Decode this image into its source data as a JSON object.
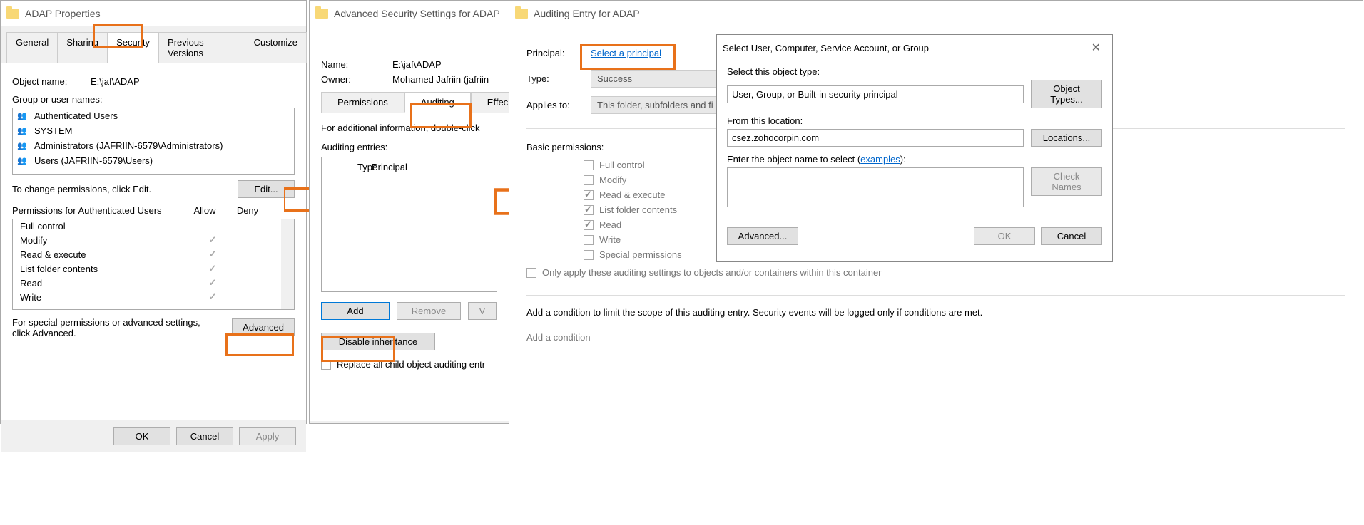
{
  "properties": {
    "title": "ADAP Properties",
    "tabs": {
      "general": "General",
      "sharing": "Sharing",
      "security": "Security",
      "previous": "Previous Versions",
      "customize": "Customize"
    },
    "object_name_label": "Object name:",
    "object_name": "E:\\jaf\\ADAP",
    "group_label": "Group or user names:",
    "groups": [
      "Authenticated Users",
      "SYSTEM",
      "Administrators (JAFRIIN-6579\\Administrators)",
      "Users (JAFRIIN-6579\\Users)"
    ],
    "change_text": "To change permissions, click Edit.",
    "edit_btn": "Edit...",
    "perm_header": "Permissions for Authenticated Users",
    "allow": "Allow",
    "deny": "Deny",
    "perms": [
      {
        "name": "Full control",
        "allow": false
      },
      {
        "name": "Modify",
        "allow": true
      },
      {
        "name": "Read & execute",
        "allow": true
      },
      {
        "name": "List folder contents",
        "allow": true
      },
      {
        "name": "Read",
        "allow": true
      },
      {
        "name": "Write",
        "allow": true
      }
    ],
    "special_text": "For special permissions or advanced settings, click Advanced.",
    "advanced_btn": "Advanced",
    "ok": "OK",
    "cancel": "Cancel",
    "apply": "Apply"
  },
  "advanced": {
    "title": "Advanced Security Settings for ADAP",
    "name_label": "Name:",
    "name": "E:\\jaf\\ADAP",
    "owner_label": "Owner:",
    "owner": "Mohamed Jafriin (jafriin",
    "tabs": {
      "permissions": "Permissions",
      "auditing": "Auditing",
      "effective": "Effec"
    },
    "info_text": "For additional information, double-click",
    "entries_label": "Auditing entries:",
    "col_type": "Type",
    "col_principal": "Principal",
    "add": "Add",
    "remove": "Remove",
    "view": "V",
    "disable": "Disable inheritance",
    "replace": "Replace all child object auditing entr"
  },
  "auditing_entry": {
    "title": "Auditing Entry for ADAP",
    "principal_label": "Principal:",
    "select_principal": "Select a principal",
    "type_label": "Type:",
    "type_value": "Success",
    "applies_label": "Applies to:",
    "applies_value": "This folder, subfolders and fi",
    "basic_label": "Basic permissions:",
    "perms": [
      {
        "name": "Full control",
        "checked": false
      },
      {
        "name": "Modify",
        "checked": false
      },
      {
        "name": "Read & execute",
        "checked": true
      },
      {
        "name": "List folder contents",
        "checked": true
      },
      {
        "name": "Read",
        "checked": true
      },
      {
        "name": "Write",
        "checked": false
      },
      {
        "name": "Special permissions",
        "checked": false
      }
    ],
    "only_apply": "Only apply these auditing settings to objects and/or containers within this container",
    "condition_text": "Add a condition to limit the scope of this auditing entry. Security events will be logged only if conditions are met.",
    "add_condition": "Add a condition"
  },
  "select_user": {
    "title": "Select User, Computer, Service Account, or Group",
    "object_type_label": "Select this object type:",
    "object_type": "User, Group, or Built-in security principal",
    "object_types_btn": "Object Types...",
    "from_label": "From this location:",
    "from": "csez.zohocorpin.com",
    "locations_btn": "Locations...",
    "enter_label": "Enter the object name to select (",
    "examples": "examples",
    "enter_label2": "):",
    "check_names": "Check Names",
    "advanced_btn": "Advanced...",
    "ok": "OK",
    "cancel": "Cancel"
  }
}
